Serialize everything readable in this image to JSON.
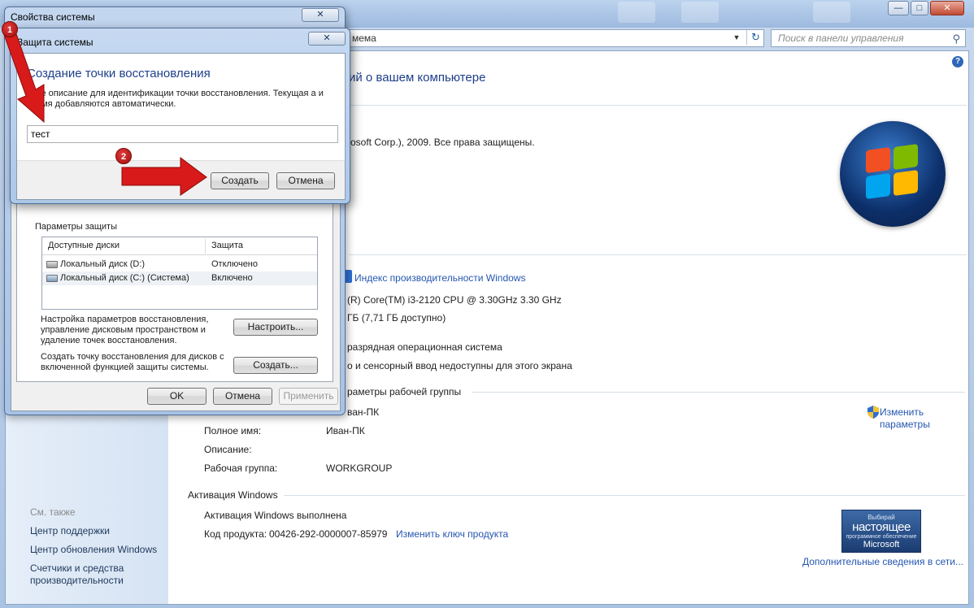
{
  "control_panel": {
    "address_text": "мема",
    "search_placeholder": "Поиск в панели управления",
    "heading": "ий о вашем компьютере",
    "copyright": "rosoft Corp.), 2009. Все права защищены.",
    "perf_link": "Индекс производительности Windows",
    "processor": "(R) Core(TM) i3-2120 CPU @ 3.30GHz   3.30 GHz",
    "memory": "ГБ (7,71 ГБ доступно)",
    "system_type": "разрядная операционная система",
    "pen_touch": "о и сенсорный ввод недоступны для этого экрана",
    "workgroup_section": "раметры рабочей группы",
    "computer_name": "ван-ПК",
    "full_name_label": "Полное имя:",
    "full_name_value": "Иван-ПК",
    "description_label": "Описание:",
    "workgroup_label": "Рабочая группа:",
    "workgroup_value": "WORKGROUP",
    "change_settings_line1": "Изменить",
    "change_settings_line2": "параметры",
    "activation_section": "Активация Windows",
    "activation_status": "Активация Windows выполнена",
    "product_key_label": "Код продукта:",
    "product_key_value": "00426-292-0000007-85979",
    "change_key_link": "Изменить ключ продукта",
    "more_info_link": "Дополнительные сведения в сети...",
    "genuine_badge": {
      "line1": "Выбирай",
      "line2": "настоящее",
      "line3": "программное обеспечение",
      "line4": "Microsoft"
    },
    "sidebar": {
      "see_also": "См. также",
      "links": [
        "Центр поддержки",
        "Центр обновления Windows",
        "Счетчики и средства производительности"
      ]
    },
    "help_glyph": "?"
  },
  "system_properties": {
    "title": "Свойства системы",
    "close_glyph": "✕",
    "protection_group_label": "Параметры защиты",
    "table": {
      "headers": [
        "Доступные диски",
        "Защита"
      ],
      "rows": [
        {
          "name": "Локальный диск (D:)",
          "status": "Отключено"
        },
        {
          "name": "Локальный диск (C:) (Система)",
          "status": "Включено"
        }
      ]
    },
    "configure_text": "Настройка параметров восстановления, управление дисковым пространством и удаление точек восстановления.",
    "configure_button": "Настроить...",
    "create_text": "Создать точку восстановления для дисков с включенной функцией защиты системы.",
    "create_button": "Создать...",
    "ok_button": "OK",
    "cancel_button": "Отмена",
    "apply_button": "Применить"
  },
  "restore_dialog": {
    "title": "Защита системы",
    "close_glyph": "✕",
    "heading": "Создание точки восстановления",
    "description": "дите описание для идентификации точки восстановления. Текущая а и время добавляются автоматически.",
    "input_value": "тест",
    "create_button": "Создать",
    "cancel_button": "Отмена"
  },
  "annotations": {
    "marker1": "1",
    "marker2": "2",
    "arrow_color": "#d91a1a"
  },
  "colors": {
    "heading_blue": "#1e3f8a",
    "link_blue": "#2556b0",
    "title_bar": "#a9c3e3"
  }
}
